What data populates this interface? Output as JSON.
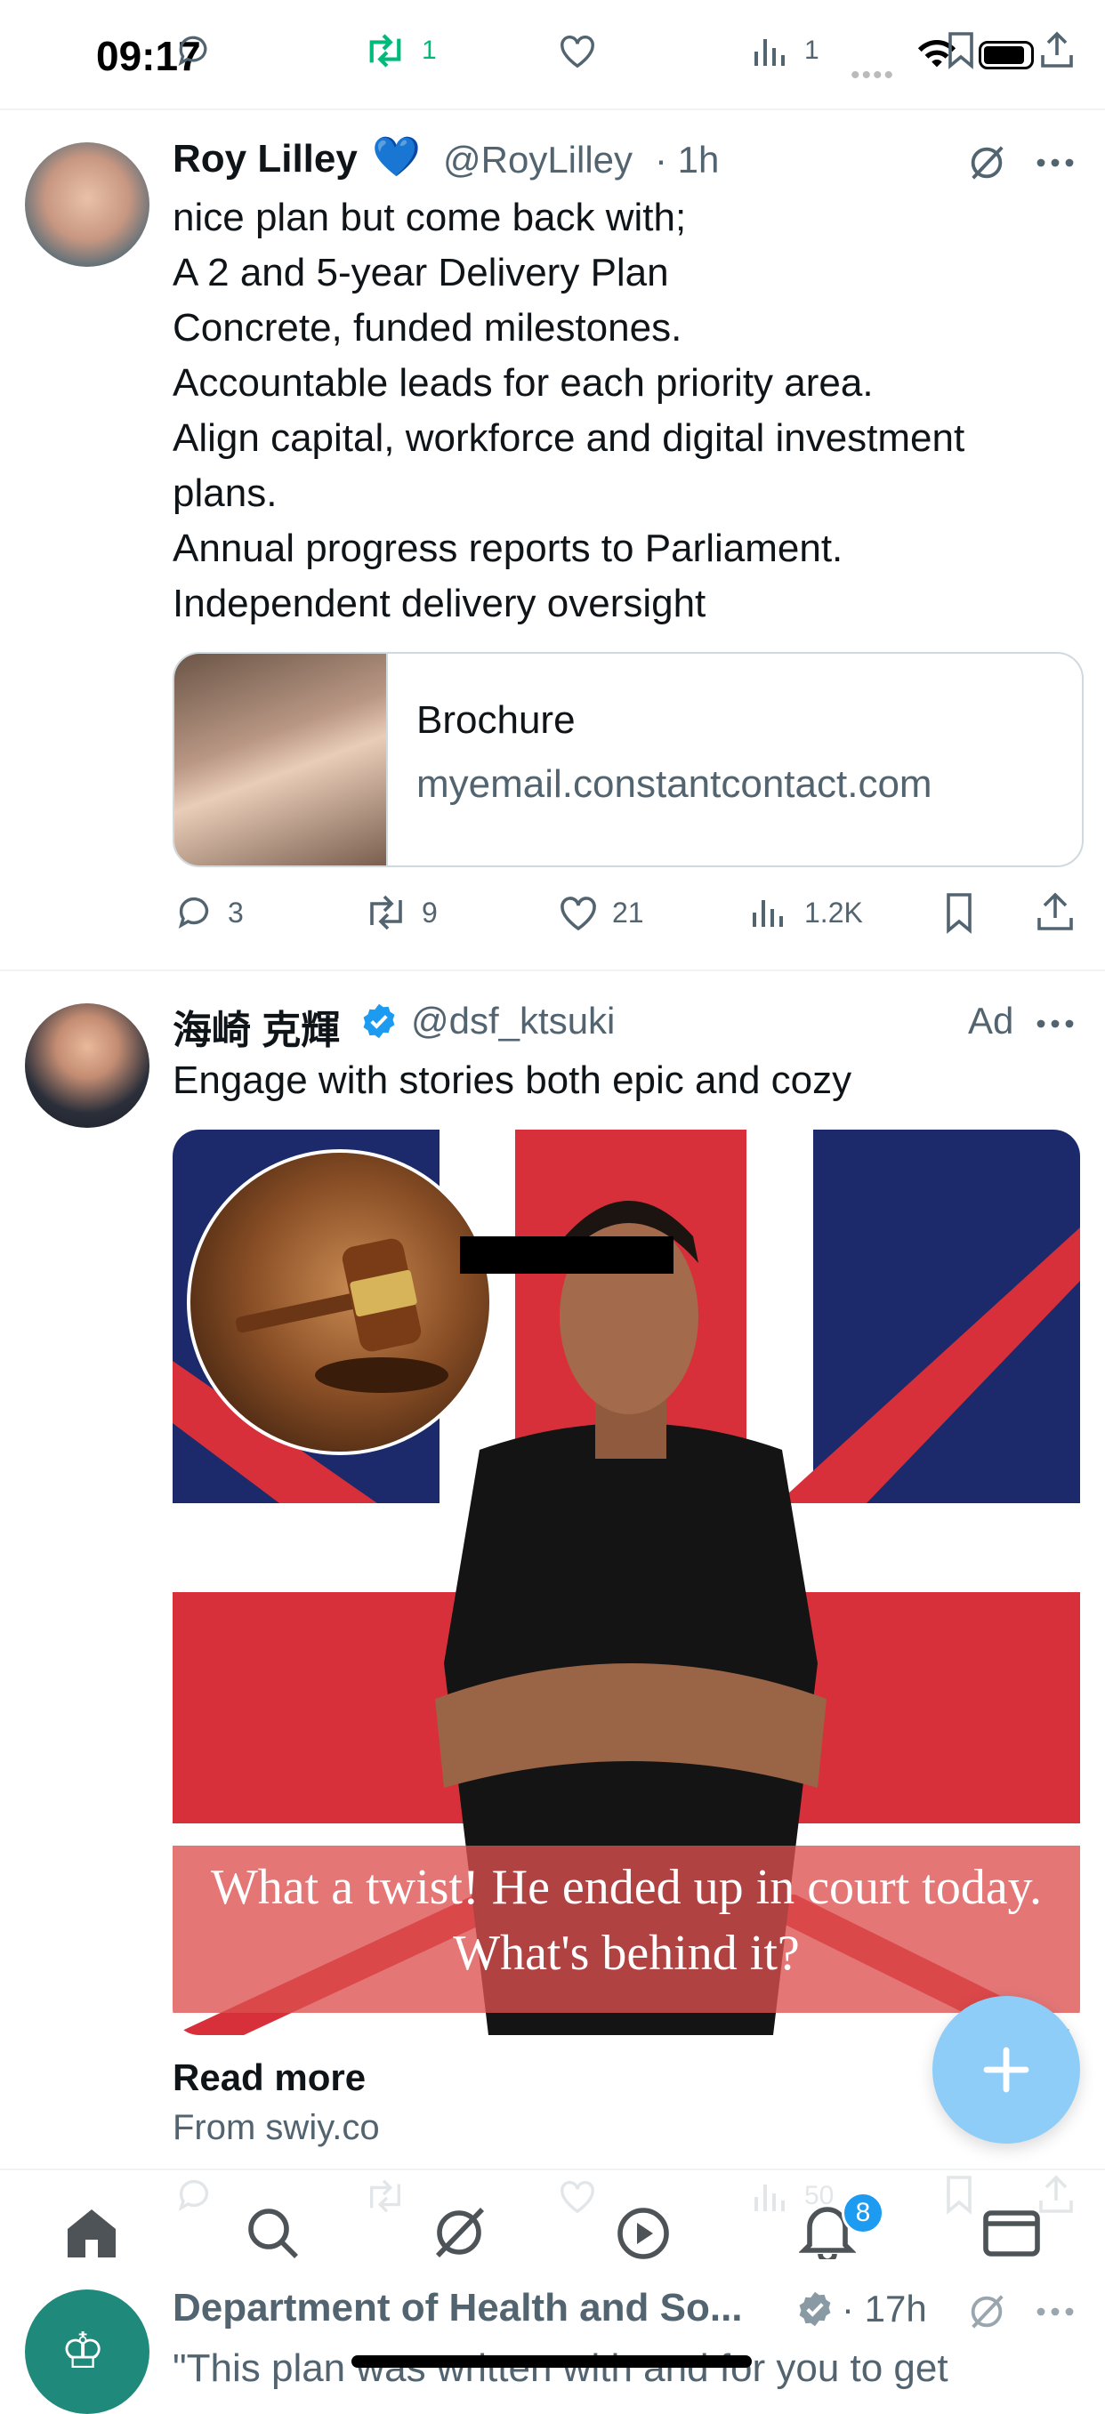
{
  "status_bar": {
    "time": "09:17",
    "retweet_count": "1",
    "views_count": "1"
  },
  "tweets": [
    {
      "name": "Roy Lilley",
      "name_emoji": "💙",
      "handle": "@RoyLilley",
      "time": "· 1h",
      "lines": [
        "nice plan but come back with;",
        "A 2 and 5-year Delivery Plan",
        "Concrete, funded milestones.",
        "Accountable leads for each priority area.",
        "Align capital, workforce and digital investment",
        "plans.",
        "Annual progress reports to Parliament.",
        "Independent delivery oversight"
      ],
      "card": {
        "title": "Brochure",
        "domain": "myemail.constantcontact.com"
      },
      "actions": {
        "replies": "3",
        "reposts": "9",
        "likes": "21",
        "views": "1.2K"
      }
    },
    {
      "name": "海崎 克輝",
      "handle": "@dsf_ktsuki",
      "ad_label": "Ad",
      "text": "Engage with stories both epic and cozy",
      "image_caption_line1": "What a twist! He ended up in court today.",
      "image_caption_line2": "What's behind it?",
      "read_more": "Read more",
      "source": "From swiy.co",
      "actions": {
        "views": "50"
      }
    },
    {
      "name": "Department of Health and So...",
      "time": "· 17h",
      "text": "\"This plan was written with and for you to get"
    }
  ],
  "bottom_nav": {
    "notification_badge": "8"
  },
  "colors": {
    "accent": "#1d9bf0",
    "repost_green": "#00ba7c",
    "secondary_text": "#536471",
    "fab": "#8ecdf8"
  },
  "icons": [
    "reply-icon",
    "repost-icon",
    "like-icon",
    "views-icon",
    "bookmark-icon",
    "share-icon",
    "grok-icon",
    "more-icon",
    "verified-icon",
    "home-icon",
    "search-icon",
    "play-icon",
    "bell-icon",
    "mail-icon",
    "plus-icon"
  ]
}
